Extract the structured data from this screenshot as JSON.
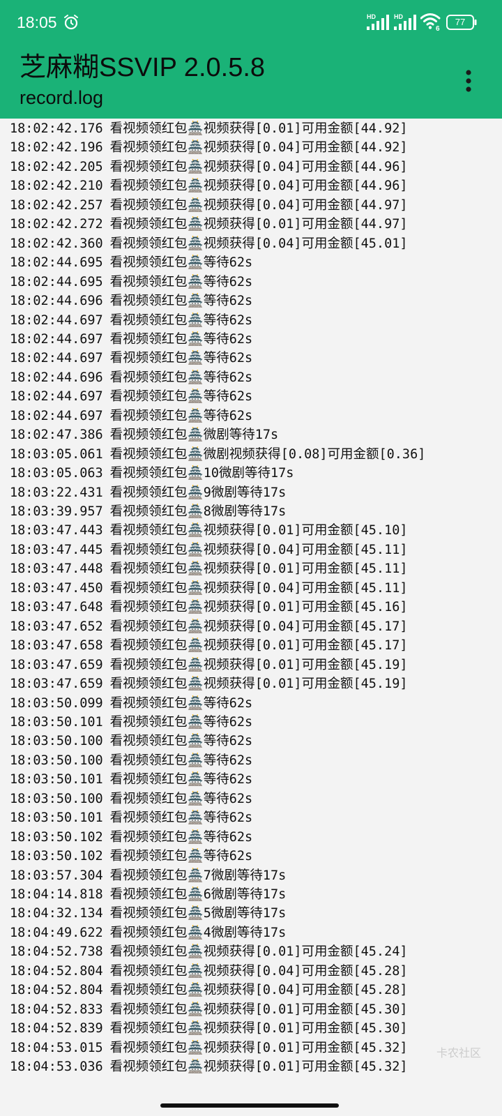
{
  "status_bar": {
    "time": "18:05",
    "battery": "77",
    "icons": [
      "alarm-icon",
      "signal-hd-icon",
      "signal-hd-icon",
      "wifi-6-icon",
      "battery-icon"
    ]
  },
  "app_bar": {
    "title": "芝麻糊SSVIP 2.0.5.8",
    "subtitle": "record.log",
    "menu_icon": "more-vertical-icon"
  },
  "log": {
    "entries": [
      {
        "time": "18:02:42.176",
        "message": "看视频领红包🏯视频获得[0.01]可用金额[44.92]"
      },
      {
        "time": "18:02:42.196",
        "message": "看视频领红包🏯视频获得[0.04]可用金额[44.92]"
      },
      {
        "time": "18:02:42.205",
        "message": "看视频领红包🏯视频获得[0.04]可用金额[44.96]"
      },
      {
        "time": "18:02:42.210",
        "message": "看视频领红包🏯视频获得[0.04]可用金额[44.96]"
      },
      {
        "time": "18:02:42.257",
        "message": "看视频领红包🏯视频获得[0.04]可用金额[44.97]"
      },
      {
        "time": "18:02:42.272",
        "message": "看视频领红包🏯视频获得[0.01]可用金额[44.97]"
      },
      {
        "time": "18:02:42.360",
        "message": "看视频领红包🏯视频获得[0.04]可用金额[45.01]"
      },
      {
        "time": "18:02:44.695",
        "message": "看视频领红包🏯等待62s"
      },
      {
        "time": "18:02:44.695",
        "message": "看视频领红包🏯等待62s"
      },
      {
        "time": "18:02:44.696",
        "message": "看视频领红包🏯等待62s"
      },
      {
        "time": "18:02:44.697",
        "message": "看视频领红包🏯等待62s"
      },
      {
        "time": "18:02:44.697",
        "message": "看视频领红包🏯等待62s"
      },
      {
        "time": "18:02:44.697",
        "message": "看视频领红包🏯等待62s"
      },
      {
        "time": "18:02:44.696",
        "message": "看视频领红包🏯等待62s"
      },
      {
        "time": "18:02:44.697",
        "message": "看视频领红包🏯等待62s"
      },
      {
        "time": "18:02:44.697",
        "message": "看视频领红包🏯等待62s"
      },
      {
        "time": "18:02:47.386",
        "message": "看视频领红包🏯微剧等待17s"
      },
      {
        "time": "18:03:05.061",
        "message": "看视频领红包🏯微剧视频获得[0.08]可用金额[0.36]"
      },
      {
        "time": "18:03:05.063",
        "message": "看视频领红包🏯10微剧等待17s"
      },
      {
        "time": "18:03:22.431",
        "message": "看视频领红包🏯9微剧等待17s"
      },
      {
        "time": "18:03:39.957",
        "message": "看视频领红包🏯8微剧等待17s"
      },
      {
        "time": "18:03:47.443",
        "message": "看视频领红包🏯视频获得[0.01]可用金额[45.10]"
      },
      {
        "time": "18:03:47.445",
        "message": "看视频领红包🏯视频获得[0.04]可用金额[45.11]"
      },
      {
        "time": "18:03:47.448",
        "message": "看视频领红包🏯视频获得[0.01]可用金额[45.11]"
      },
      {
        "time": "18:03:47.450",
        "message": "看视频领红包🏯视频获得[0.04]可用金额[45.11]"
      },
      {
        "time": "18:03:47.648",
        "message": "看视频领红包🏯视频获得[0.01]可用金额[45.16]"
      },
      {
        "time": "18:03:47.652",
        "message": "看视频领红包🏯视频获得[0.04]可用金额[45.17]"
      },
      {
        "time": "18:03:47.658",
        "message": "看视频领红包🏯视频获得[0.01]可用金额[45.17]"
      },
      {
        "time": "18:03:47.659",
        "message": "看视频领红包🏯视频获得[0.01]可用金额[45.19]"
      },
      {
        "time": "18:03:47.659",
        "message": "看视频领红包🏯视频获得[0.01]可用金额[45.19]"
      },
      {
        "time": "18:03:50.099",
        "message": "看视频领红包🏯等待62s"
      },
      {
        "time": "18:03:50.101",
        "message": "看视频领红包🏯等待62s"
      },
      {
        "time": "18:03:50.100",
        "message": "看视频领红包🏯等待62s"
      },
      {
        "time": "18:03:50.100",
        "message": "看视频领红包🏯等待62s"
      },
      {
        "time": "18:03:50.101",
        "message": "看视频领红包🏯等待62s"
      },
      {
        "time": "18:03:50.100",
        "message": "看视频领红包🏯等待62s"
      },
      {
        "time": "18:03:50.101",
        "message": "看视频领红包🏯等待62s"
      },
      {
        "time": "18:03:50.102",
        "message": "看视频领红包🏯等待62s"
      },
      {
        "time": "18:03:50.102",
        "message": "看视频领红包🏯等待62s"
      },
      {
        "time": "18:03:57.304",
        "message": "看视频领红包🏯7微剧等待17s"
      },
      {
        "time": "18:04:14.818",
        "message": "看视频领红包🏯6微剧等待17s"
      },
      {
        "time": "18:04:32.134",
        "message": "看视频领红包🏯5微剧等待17s"
      },
      {
        "time": "18:04:49.622",
        "message": "看视频领红包🏯4微剧等待17s"
      },
      {
        "time": "18:04:52.738",
        "message": "看视频领红包🏯视频获得[0.01]可用金额[45.24]"
      },
      {
        "time": "18:04:52.804",
        "message": "看视频领红包🏯视频获得[0.04]可用金额[45.28]"
      },
      {
        "time": "18:04:52.804",
        "message": "看视频领红包🏯视频获得[0.04]可用金额[45.28]"
      },
      {
        "time": "18:04:52.833",
        "message": "看视频领红包🏯视频获得[0.01]可用金额[45.30]"
      },
      {
        "time": "18:04:52.839",
        "message": "看视频领红包🏯视频获得[0.01]可用金额[45.30]"
      },
      {
        "time": "18:04:53.015",
        "message": "看视频领红包🏯视频获得[0.01]可用金额[45.32]"
      },
      {
        "time": "18:04:53.036",
        "message": "看视频领红包🏯视频获得[0.01]可用金额[45.32]"
      }
    ]
  },
  "watermark": "卡农社区",
  "colors": {
    "app_bar": "#1ab277",
    "background": "#f3f3f3",
    "text": "#111111"
  }
}
